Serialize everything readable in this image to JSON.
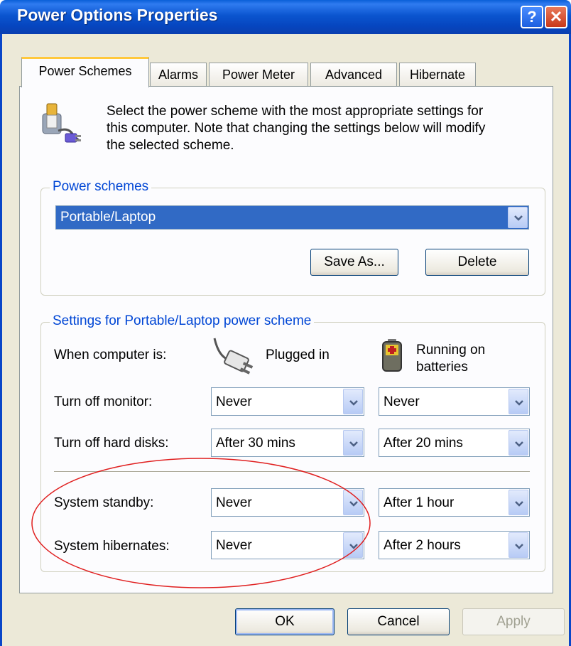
{
  "window": {
    "title": "Power Options Properties",
    "help_glyph": "?",
    "close_glyph": "✕"
  },
  "tabs": [
    {
      "label": "Power Schemes",
      "active": true
    },
    {
      "label": "Alarms",
      "active": false
    },
    {
      "label": "Power Meter",
      "active": false
    },
    {
      "label": "Advanced",
      "active": false
    },
    {
      "label": "Hibernate",
      "active": false
    }
  ],
  "intro": {
    "icon": "power-scheme-icon",
    "line1": "Select the power scheme with the most appropriate settings for",
    "line2": "this computer. Note that changing the settings below will modify",
    "line3": "the selected scheme."
  },
  "schemes_group": {
    "label": "Power schemes",
    "selected": "Portable/Laptop",
    "save_as_label": "Save As...",
    "delete_label": "Delete"
  },
  "settings_group": {
    "label": "Settings for Portable/Laptop power scheme",
    "when_label": "When computer is:",
    "plugged_in_label": "Plugged in",
    "running_on_label": "Running on",
    "batteries_label": "batteries",
    "rows": [
      {
        "label": "Turn off monitor:",
        "plugged": "Never",
        "battery": "Never"
      },
      {
        "label": "Turn off hard disks:",
        "plugged": "After 30 mins",
        "battery": "After 20 mins"
      },
      {
        "label": "System standby:",
        "plugged": "Never",
        "battery": "After 1 hour"
      },
      {
        "label": "System hibernates:",
        "plugged": "Never",
        "battery": "After 2 hours"
      }
    ]
  },
  "footer": {
    "ok_label": "OK",
    "cancel_label": "Cancel",
    "apply_label": "Apply"
  },
  "colors": {
    "title_bar": "#0a55cf",
    "group_label": "#0046d5",
    "selection": "#316ac5",
    "annotation": "#e02020"
  }
}
